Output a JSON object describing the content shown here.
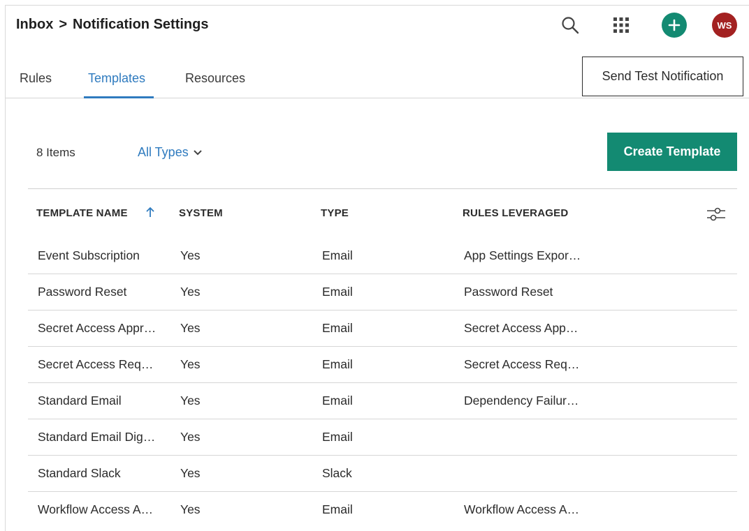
{
  "header": {
    "breadcrumb_parent": "Inbox",
    "breadcrumb_separator": ">",
    "breadcrumb_current": "Notification Settings",
    "avatar_initials": "WS"
  },
  "tabs": [
    {
      "label": "Rules",
      "active": false
    },
    {
      "label": "Templates",
      "active": true
    },
    {
      "label": "Resources",
      "active": false
    }
  ],
  "send_test_label": "Send Test Notification",
  "toolbar": {
    "items_count": "8 Items",
    "filter_label": "All Types",
    "create_label": "Create Template"
  },
  "table": {
    "columns": [
      "TEMPLATE NAME",
      "SYSTEM",
      "TYPE",
      "RULES LEVERAGED"
    ],
    "rows": [
      {
        "name": "Event Subscription",
        "system": "Yes",
        "type": "Email",
        "rules": "App Settings Expor…"
      },
      {
        "name": "Password Reset",
        "system": "Yes",
        "type": "Email",
        "rules": "Password Reset"
      },
      {
        "name": "Secret Access Appr…",
        "system": "Yes",
        "type": "Email",
        "rules": "Secret Access App…"
      },
      {
        "name": "Secret Access Req…",
        "system": "Yes",
        "type": "Email",
        "rules": "Secret Access Req…"
      },
      {
        "name": "Standard Email",
        "system": "Yes",
        "type": "Email",
        "rules": "Dependency Failur…"
      },
      {
        "name": "Standard Email Dig…",
        "system": "Yes",
        "type": "Email",
        "rules": ""
      },
      {
        "name": "Standard Slack",
        "system": "Yes",
        "type": "Slack",
        "rules": ""
      },
      {
        "name": "Workflow Access A…",
        "system": "Yes",
        "type": "Email",
        "rules": "Workflow Access A…"
      }
    ]
  },
  "colors": {
    "accent_blue": "#2f7bbf",
    "brand_green": "#138a72",
    "avatar_red": "#a32121"
  }
}
